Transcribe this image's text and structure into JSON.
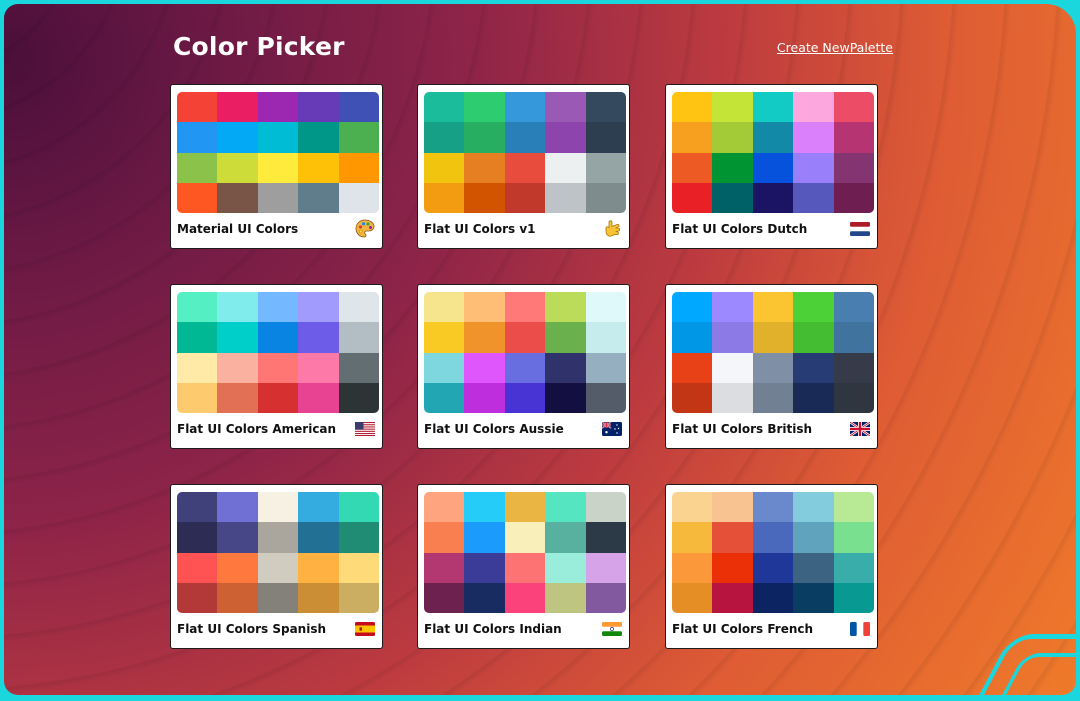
{
  "app": {
    "title": "Color Picker",
    "create_link": "Create NewPalette"
  },
  "palettes": [
    {
      "name": "Material UI Colors",
      "icon": "artist-palette-icon",
      "colors": [
        "#f44336",
        "#e91e63",
        "#9c27b0",
        "#673ab7",
        "#3f51b5",
        "#2196f3",
        "#03a9f4",
        "#00bcd4",
        "#009688",
        "#4caf50",
        "#8bc34a",
        "#cddc39",
        "#ffeb3b",
        "#ffc107",
        "#ff9800",
        "#ff5722",
        "#795548",
        "#9e9e9e",
        "#607d8b",
        "#dfe4ea"
      ]
    },
    {
      "name": "Flat UI Colors v1",
      "icon": "hand-icon",
      "colors": [
        "#1abc9c",
        "#2ecc71",
        "#3498db",
        "#9b59b6",
        "#34495e",
        "#16a085",
        "#27ae60",
        "#2980b9",
        "#8e44ad",
        "#2c3e50",
        "#f1c40f",
        "#e67e22",
        "#e74c3c",
        "#ecf0f1",
        "#95a5a6",
        "#f39c12",
        "#d35400",
        "#c0392b",
        "#bdc3c7",
        "#7f8c8d"
      ]
    },
    {
      "name": "Flat UI Colors Dutch",
      "icon": "netherlands-flag-icon",
      "colors": [
        "#ffc312",
        "#c4e538",
        "#12cbc4",
        "#fda7df",
        "#ed4c67",
        "#f79f1f",
        "#a3cb38",
        "#1289a7",
        "#d980fa",
        "#b53471",
        "#ee5a24",
        "#009432",
        "#0652dd",
        "#9980fa",
        "#833471",
        "#ea2027",
        "#006266",
        "#1b1464",
        "#5758bb",
        "#6f1e51"
      ]
    },
    {
      "name": "Flat UI Colors American",
      "icon": "usa-flag-icon",
      "colors": [
        "#55efc4",
        "#81ecec",
        "#74b9ff",
        "#a29bfe",
        "#dfe6e9",
        "#00b894",
        "#00cec9",
        "#0984e3",
        "#6c5ce7",
        "#b2bec3",
        "#ffeaa7",
        "#fab1a0",
        "#ff7675",
        "#fd79a8",
        "#636e72",
        "#fdcb6e",
        "#e17055",
        "#d63031",
        "#e84393",
        "#2d3436"
      ]
    },
    {
      "name": "Flat UI Colors Aussie",
      "icon": "australia-flag-icon",
      "colors": [
        "#f6e58d",
        "#ffbe76",
        "#ff7979",
        "#badc58",
        "#dff9fb",
        "#f9ca24",
        "#f0932b",
        "#eb4d4b",
        "#6ab04c",
        "#c7ecee",
        "#7ed6df",
        "#e056fd",
        "#686de0",
        "#30336b",
        "#95afc0",
        "#22a6b3",
        "#be2edd",
        "#4834d4",
        "#130f40",
        "#535c68"
      ]
    },
    {
      "name": "Flat UI Colors British",
      "icon": "uk-flag-icon",
      "colors": [
        "#00a8ff",
        "#9c88ff",
        "#fbc531",
        "#4cd137",
        "#487eb0",
        "#0097e6",
        "#8c7ae6",
        "#e1b12c",
        "#44bd32",
        "#40739e",
        "#e84118",
        "#f5f6fa",
        "#7f8fa6",
        "#273c75",
        "#353b48",
        "#c23616",
        "#dcdde1",
        "#718093",
        "#192a56",
        "#2f3640"
      ]
    },
    {
      "name": "Flat UI Colors Spanish",
      "icon": "spain-flag-icon",
      "colors": [
        "#40407a",
        "#706fd3",
        "#f7f1e3",
        "#34ace0",
        "#33d9b2",
        "#2c2c54",
        "#474787",
        "#aaa69d",
        "#227093",
        "#218c74",
        "#ff5252",
        "#ff793f",
        "#d1ccc0",
        "#ffb142",
        "#ffda79",
        "#b33939",
        "#cd6133",
        "#84817a",
        "#cc8e35",
        "#ccae62"
      ]
    },
    {
      "name": "Flat UI Colors Indian",
      "icon": "india-flag-icon",
      "colors": [
        "#fea47f",
        "#25ccf7",
        "#eab543",
        "#55e6c1",
        "#cad3c8",
        "#f97f51",
        "#1b9cfc",
        "#f8efba",
        "#58b19f",
        "#2c3a47",
        "#b33771",
        "#3b3b98",
        "#fd7272",
        "#9aecdb",
        "#d6a2e8",
        "#6d214f",
        "#182c61",
        "#fc427b",
        "#bdc581",
        "#82589f"
      ]
    },
    {
      "name": "Flat UI Colors French",
      "icon": "france-flag-icon",
      "colors": [
        "#fad390",
        "#f8c291",
        "#6a89cc",
        "#82ccdd",
        "#b8e994",
        "#f6b93b",
        "#e55039",
        "#4a69bd",
        "#60a3bc",
        "#78e08f",
        "#fa983a",
        "#eb2f06",
        "#1e3799",
        "#3c6382",
        "#38ada9",
        "#e58e26",
        "#b71540",
        "#0c2461",
        "#0a3d62",
        "#079992"
      ]
    }
  ]
}
